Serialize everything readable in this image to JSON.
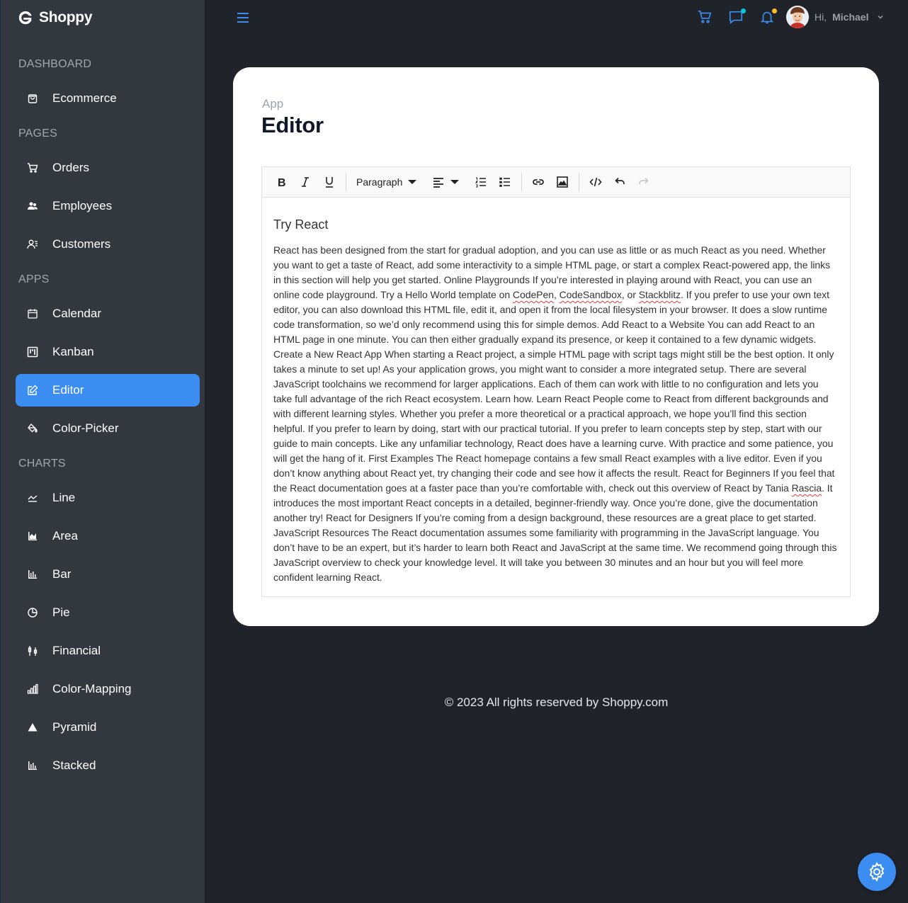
{
  "app": {
    "name": "Shoppy"
  },
  "sidebar": {
    "sections": [
      {
        "title": "DASHBOARD",
        "items": [
          {
            "label": "Ecommerce",
            "icon": "shopping-bag-icon"
          }
        ]
      },
      {
        "title": "PAGES",
        "items": [
          {
            "label": "Orders",
            "icon": "cart-icon"
          },
          {
            "label": "Employees",
            "icon": "employees-icon"
          },
          {
            "label": "Customers",
            "icon": "customers-icon"
          }
        ]
      },
      {
        "title": "APPS",
        "items": [
          {
            "label": "Calendar",
            "icon": "calendar-icon"
          },
          {
            "label": "Kanban",
            "icon": "kanban-icon"
          },
          {
            "label": "Editor",
            "icon": "edit-icon",
            "active": true
          },
          {
            "label": "Color-Picker",
            "icon": "paint-bucket-icon"
          }
        ]
      },
      {
        "title": "CHARTS",
        "items": [
          {
            "label": "Line",
            "icon": "line-chart-icon"
          },
          {
            "label": "Area",
            "icon": "area-chart-icon"
          },
          {
            "label": "Bar",
            "icon": "bar-chart-icon"
          },
          {
            "label": "Pie",
            "icon": "pie-chart-icon"
          },
          {
            "label": "Financial",
            "icon": "financial-chart-icon"
          },
          {
            "label": "Color-Mapping",
            "icon": "color-mapping-icon"
          },
          {
            "label": "Pyramid",
            "icon": "pyramid-icon"
          },
          {
            "label": "Stacked",
            "icon": "stacked-chart-icon"
          }
        ]
      }
    ]
  },
  "topbar": {
    "greeting": "Hi,",
    "user_name": "Michael",
    "icons": [
      "menu-icon",
      "cart-icon",
      "chat-icon",
      "bell-icon"
    ]
  },
  "page": {
    "breadcrumb": "App",
    "title": "Editor"
  },
  "editor": {
    "toolbar": {
      "format_label": "Paragraph"
    },
    "heading": "Try React",
    "body_parts": {
      "p1": "React has been designed from the start for gradual adoption, and you can use as little or as much React as you need. Whether you want to get a taste of React, add some interactivity to a simple HTML page, or start a complex React-powered app, the links in this section will help you get started. Online Playgrounds If you’re interested in playing around with React, you can use an online code playground. Try a Hello World template on ",
      "link1": "CodePen",
      "sep1": ", ",
      "link2": "CodeSandbox",
      "sep2": ", or ",
      "link3": "Stackblitz",
      "p2": ". If you prefer to use your own text editor, you can also download this HTML file, edit it, and open it from the local filesystem in your browser. It does a slow runtime code transformation, so we’d only recommend using this for simple demos. Add React to a Website You can add React to an HTML page in one minute. You can then either gradually expand its presence, or keep it contained to a few dynamic widgets. Create a New React App When starting a React project, a simple HTML page with script tags might still be the best option. It only takes a minute to set up! As your application grows, you might want to consider a more integrated setup. There are several JavaScript toolchains we recommend for larger applications. Each of them can work with little to no configuration and lets you take full advantage of the rich React ecosystem. Learn how. Learn React People come to React from different backgrounds and with different learning styles. Whether you prefer a more theoretical or a practical approach, we hope you’ll find this section helpful. If you prefer to learn by doing, start with our practical tutorial. If you prefer to learn concepts step by step, start with our guide to main concepts. Like any unfamiliar technology, React does have a learning curve. With practice and some patience, you will get the hang of it. First Examples The React homepage contains a few small React examples with a live editor. Even if you don’t know anything about React yet, try changing their code and see how it affects the result. React for Beginners If you feel that the React documentation goes at a faster pace than you’re comfortable with, check out this overview of React by Tania ",
      "name": "Rascia",
      "p3": ". It introduces the most important React concepts in a detailed, beginner-friendly way. Once you’re done, give the documentation another try! React for Designers If you’re coming from a design background, these resources are a great place to get started. JavaScript Resources The React documentation assumes some familiarity with programming in the JavaScript language. You don’t have to be an expert, but it’s harder to learn both React and JavaScript at the same time. We recommend going through this JavaScript overview to check your knowledge level. It will take you between 30 minutes and an hour but you will feel more confident learning React."
    }
  },
  "footer": {
    "text": "© 2023 All rights reserved by Shoppy.com"
  },
  "colors": {
    "accent": "#3b8df1",
    "sidebar_bg": "#33373e",
    "page_bg": "#20232a",
    "notification_dot": "#fbbf24",
    "chat_dot": "#03c9d7"
  }
}
